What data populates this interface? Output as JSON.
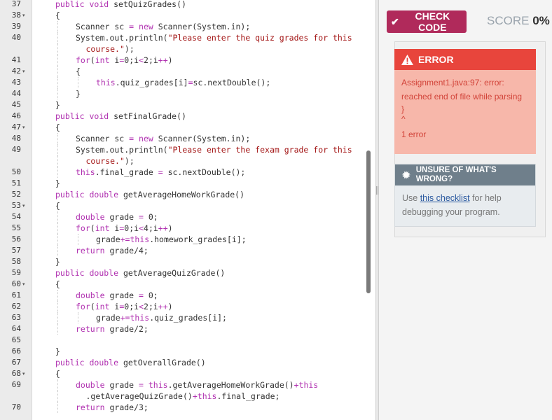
{
  "editor": {
    "lines": [
      {
        "n": "37",
        "fold": "",
        "tokens": [
          [
            "kw",
            "public "
          ],
          [
            "kw",
            "void "
          ],
          [
            "id",
            "setQuizGrades()"
          ]
        ],
        "indent": 0
      },
      {
        "n": "38",
        "fold": "▾",
        "tokens": [
          [
            "id",
            "{"
          ]
        ],
        "indent": 0
      },
      {
        "n": "39",
        "fold": "",
        "tokens": [
          [
            "id",
            "Scanner sc "
          ],
          [
            "op",
            "= "
          ],
          [
            "kw",
            "new "
          ],
          [
            "id",
            "Scanner(System.in);"
          ]
        ],
        "indent": 1
      },
      {
        "n": "40",
        "fold": "",
        "tokens": [
          [
            "id",
            "System.out.println("
          ],
          [
            "str",
            "\"Please enter the quiz grades for this"
          ]
        ],
        "indent": 1
      },
      {
        "n": "",
        "fold": "",
        "tokens": [
          [
            "str",
            "course.\""
          ],
          [
            "id",
            ");"
          ]
        ],
        "indent": 1.5
      },
      {
        "n": "41",
        "fold": "",
        "tokens": [
          [
            "kw",
            "for"
          ],
          [
            "id",
            "("
          ],
          [
            "kw",
            "int "
          ],
          [
            "id",
            "i"
          ],
          [
            "op",
            "="
          ],
          [
            "id",
            "0;i"
          ],
          [
            "op",
            "<"
          ],
          [
            "id",
            "2;i"
          ],
          [
            "op",
            "++"
          ],
          [
            "id",
            ")"
          ]
        ],
        "indent": 1
      },
      {
        "n": "42",
        "fold": "▾",
        "tokens": [
          [
            "id",
            "{"
          ]
        ],
        "indent": 1
      },
      {
        "n": "43",
        "fold": "",
        "tokens": [
          [
            "kw",
            "this"
          ],
          [
            "id",
            ".quiz_grades[i]"
          ],
          [
            "op",
            "="
          ],
          [
            "id",
            "sc.nextDouble();"
          ]
        ],
        "indent": 2
      },
      {
        "n": "44",
        "fold": "",
        "tokens": [
          [
            "id",
            "}"
          ]
        ],
        "indent": 1
      },
      {
        "n": "45",
        "fold": "",
        "tokens": [
          [
            "id",
            "}"
          ]
        ],
        "indent": 0
      },
      {
        "n": "46",
        "fold": "",
        "tokens": [
          [
            "kw",
            "public "
          ],
          [
            "kw",
            "void "
          ],
          [
            "id",
            "setFinalGrade()"
          ]
        ],
        "indent": 0
      },
      {
        "n": "47",
        "fold": "▾",
        "tokens": [
          [
            "id",
            "{"
          ]
        ],
        "indent": 0
      },
      {
        "n": "48",
        "fold": "",
        "tokens": [
          [
            "id",
            "Scanner sc "
          ],
          [
            "op",
            "= "
          ],
          [
            "kw",
            "new "
          ],
          [
            "id",
            "Scanner(System.in);"
          ]
        ],
        "indent": 1
      },
      {
        "n": "49",
        "fold": "",
        "tokens": [
          [
            "id",
            "System.out.println("
          ],
          [
            "str",
            "\"Please enter the fexam grade for this"
          ]
        ],
        "indent": 1
      },
      {
        "n": "",
        "fold": "",
        "tokens": [
          [
            "str",
            "course.\""
          ],
          [
            "id",
            ");"
          ]
        ],
        "indent": 1.5
      },
      {
        "n": "50",
        "fold": "",
        "tokens": [
          [
            "kw",
            "this"
          ],
          [
            "id",
            ".final_grade "
          ],
          [
            "op",
            "= "
          ],
          [
            "id",
            "sc.nextDouble();"
          ]
        ],
        "indent": 1
      },
      {
        "n": "51",
        "fold": "",
        "tokens": [
          [
            "id",
            "}"
          ]
        ],
        "indent": 0
      },
      {
        "n": "52",
        "fold": "",
        "tokens": [
          [
            "kw",
            "public "
          ],
          [
            "kw",
            "double "
          ],
          [
            "id",
            "getAverageHomeWorkGrade()"
          ]
        ],
        "indent": 0
      },
      {
        "n": "53",
        "fold": "▾",
        "tokens": [
          [
            "id",
            "{"
          ]
        ],
        "indent": 0
      },
      {
        "n": "54",
        "fold": "",
        "tokens": [
          [
            "kw",
            "double "
          ],
          [
            "id",
            "grade "
          ],
          [
            "op",
            "= "
          ],
          [
            "id",
            "0;"
          ]
        ],
        "indent": 1
      },
      {
        "n": "55",
        "fold": "",
        "tokens": [
          [
            "kw",
            "for"
          ],
          [
            "id",
            "("
          ],
          [
            "kw",
            "int "
          ],
          [
            "id",
            "i"
          ],
          [
            "op",
            "="
          ],
          [
            "id",
            "0;i"
          ],
          [
            "op",
            "<"
          ],
          [
            "id",
            "4;i"
          ],
          [
            "op",
            "++"
          ],
          [
            "id",
            ")"
          ]
        ],
        "indent": 1
      },
      {
        "n": "56",
        "fold": "",
        "tokens": [
          [
            "id",
            "grade"
          ],
          [
            "op",
            "+="
          ],
          [
            "kw",
            "this"
          ],
          [
            "id",
            ".homework_grades[i];"
          ]
        ],
        "indent": 2
      },
      {
        "n": "57",
        "fold": "",
        "tokens": [
          [
            "kw",
            "return "
          ],
          [
            "id",
            "grade/4;"
          ]
        ],
        "indent": 1
      },
      {
        "n": "58",
        "fold": "",
        "tokens": [
          [
            "id",
            "}"
          ]
        ],
        "indent": 0
      },
      {
        "n": "59",
        "fold": "",
        "tokens": [
          [
            "kw",
            "public "
          ],
          [
            "kw",
            "double "
          ],
          [
            "id",
            "getAverageQuizGrade()"
          ]
        ],
        "indent": 0
      },
      {
        "n": "60",
        "fold": "▾",
        "tokens": [
          [
            "id",
            "{"
          ]
        ],
        "indent": 0
      },
      {
        "n": "61",
        "fold": "",
        "tokens": [
          [
            "kw",
            "double "
          ],
          [
            "id",
            "grade "
          ],
          [
            "op",
            "= "
          ],
          [
            "id",
            "0;"
          ]
        ],
        "indent": 1
      },
      {
        "n": "62",
        "fold": "",
        "tokens": [
          [
            "kw",
            "for"
          ],
          [
            "id",
            "("
          ],
          [
            "kw",
            "int "
          ],
          [
            "id",
            "i"
          ],
          [
            "op",
            "="
          ],
          [
            "id",
            "0;i"
          ],
          [
            "op",
            "<"
          ],
          [
            "id",
            "2;i"
          ],
          [
            "op",
            "++"
          ],
          [
            "id",
            ")"
          ]
        ],
        "indent": 1
      },
      {
        "n": "63",
        "fold": "",
        "tokens": [
          [
            "id",
            "grade"
          ],
          [
            "op",
            "+="
          ],
          [
            "kw",
            "this"
          ],
          [
            "id",
            ".quiz_grades[i];"
          ]
        ],
        "indent": 2
      },
      {
        "n": "64",
        "fold": "",
        "tokens": [
          [
            "kw",
            "return "
          ],
          [
            "id",
            "grade/2;"
          ]
        ],
        "indent": 1
      },
      {
        "n": "65",
        "fold": "",
        "tokens": [],
        "indent": 0
      },
      {
        "n": "66",
        "fold": "",
        "tokens": [
          [
            "id",
            "}"
          ]
        ],
        "indent": 0
      },
      {
        "n": "67",
        "fold": "",
        "tokens": [
          [
            "kw",
            "public "
          ],
          [
            "kw",
            "double "
          ],
          [
            "id",
            "getOverallGrade()"
          ]
        ],
        "indent": 0
      },
      {
        "n": "68",
        "fold": "▾",
        "tokens": [
          [
            "id",
            "{"
          ]
        ],
        "indent": 0
      },
      {
        "n": "69",
        "fold": "",
        "tokens": [
          [
            "kw",
            "double "
          ],
          [
            "id",
            "grade "
          ],
          [
            "op",
            "= "
          ],
          [
            "kw",
            "this"
          ],
          [
            "id",
            ".getAverageHomeWorkGrade()"
          ],
          [
            "op",
            "+"
          ],
          [
            "kw",
            "this"
          ]
        ],
        "indent": 1
      },
      {
        "n": "",
        "fold": "",
        "tokens": [
          [
            "id",
            ".getAverageQuizGrade()"
          ],
          [
            "op",
            "+"
          ],
          [
            "kw",
            "this"
          ],
          [
            "id",
            ".final_grade;"
          ]
        ],
        "indent": 1.5
      },
      {
        "n": "70",
        "fold": "",
        "tokens": [
          [
            "kw",
            "return "
          ],
          [
            "id",
            "grade/3;"
          ]
        ],
        "indent": 1
      }
    ]
  },
  "toolbar": {
    "check_label": "CHECK CODE",
    "check_icon": "checkmark-icon",
    "score_label": "SCORE",
    "score_value": "0%"
  },
  "error": {
    "title": "ERROR",
    "icon": "warning-icon",
    "lines": [
      "Assignment1.java:97: error:",
      "reached end of file while parsing",
      "}",
      "^",
      "1 error"
    ]
  },
  "help": {
    "title": "UNSURE OF WHAT'S WRONG?",
    "icon": "bug-icon",
    "body_prefix": "Use ",
    "link": "this checklist",
    "body_suffix": " for help debugging your program."
  },
  "colors": {
    "accent": "#b02a5b",
    "error": "#e8453c",
    "error_bg": "#f7b7aa",
    "keyword": "#b030b0"
  }
}
